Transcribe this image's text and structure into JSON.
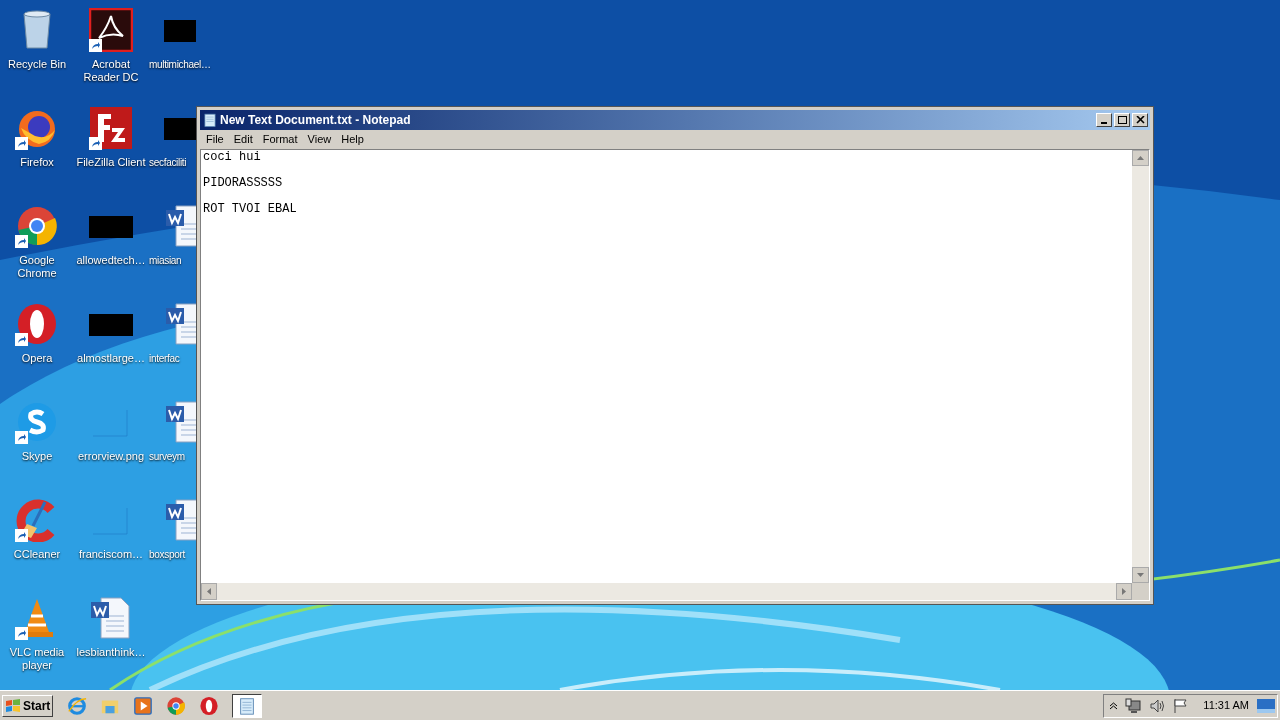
{
  "desktop": {
    "columns": [
      {
        "icons": [
          {
            "label": "Recycle Bin",
            "kind": "recycle"
          },
          {
            "label": "Firefox",
            "kind": "firefox"
          },
          {
            "label": "Google Chrome",
            "kind": "chrome"
          },
          {
            "label": "Opera",
            "kind": "opera"
          },
          {
            "label": "Skype",
            "kind": "skype"
          },
          {
            "label": "CCleaner",
            "kind": "ccleaner"
          },
          {
            "label": "VLC media player",
            "kind": "vlc"
          }
        ]
      },
      {
        "icons": [
          {
            "label": "Acrobat Reader DC",
            "kind": "acrobat"
          },
          {
            "label": "FileZilla Client",
            "kind": "filezilla"
          },
          {
            "label": "allowedtech…",
            "kind": "hidden"
          },
          {
            "label": "almostlarge…",
            "kind": "hidden"
          },
          {
            "label": "errorview.png",
            "kind": "blank"
          },
          {
            "label": "franciscom…",
            "kind": "blank"
          },
          {
            "label": "lesbianthink…",
            "kind": "word"
          }
        ]
      },
      {
        "icons": [
          {
            "label": "multimichael…",
            "kind": "hidden"
          },
          {
            "label": "secfaciliti",
            "kind": "hidden"
          },
          {
            "label": "miasian",
            "kind": "word"
          },
          {
            "label": "interfac",
            "kind": "word"
          },
          {
            "label": "surveym",
            "kind": "word"
          },
          {
            "label": "boxsport",
            "kind": "word"
          }
        ]
      }
    ]
  },
  "window": {
    "title": "New Text Document.txt - Notepad",
    "menu": [
      "File",
      "Edit",
      "Format",
      "View",
      "Help"
    ],
    "text": "coci hui\n\nPIDORASSSSS\n\nROT TVOI EBAL"
  },
  "taskbar": {
    "start": "Start",
    "apps": [
      {
        "kind": "ie",
        "selected": false
      },
      {
        "kind": "explorer",
        "selected": false
      },
      {
        "kind": "media",
        "selected": false
      },
      {
        "kind": "chrome",
        "selected": false
      },
      {
        "kind": "opera",
        "selected": false
      },
      {
        "kind": "notepad",
        "selected": true
      }
    ],
    "clock": "11:31 AM"
  }
}
